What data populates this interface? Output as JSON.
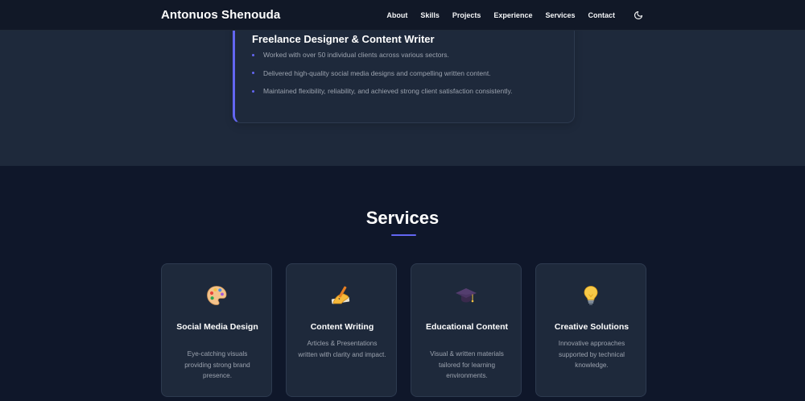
{
  "nav": {
    "brand": "Antonuos Shenouda",
    "links": [
      "About",
      "Skills",
      "Projects",
      "Experience",
      "Services",
      "Contact"
    ],
    "theme_icon": "moon-icon"
  },
  "experience": {
    "title": "Freelance Designer & Content Writer",
    "bullets": [
      "Worked with over 50 individual clients across various sectors.",
      "Delivered high-quality social media designs and compelling written content.",
      "Maintained flexibility, reliability, and achieved strong client satisfaction consistently."
    ]
  },
  "services": {
    "heading": "Services",
    "cards": [
      {
        "icon": "palette-icon",
        "title": "Social Media Design",
        "desc": "Eye-catching visuals providing strong brand presence."
      },
      {
        "icon": "writing-hand-icon",
        "title": "Content Writing",
        "desc": "Articles & Presentations written with clarity and impact."
      },
      {
        "icon": "graduation-cap-icon",
        "title": "Educational Content",
        "desc": "Visual & written materials tailored for learning environments."
      },
      {
        "icon": "light-bulb-icon",
        "title": "Creative Solutions",
        "desc": "Innovative approaches supported by technical knowledge."
      }
    ]
  },
  "colors": {
    "accent": "#6366f1",
    "background": "#0f172a",
    "surface": "#1e293b",
    "navbar": "#111827"
  }
}
